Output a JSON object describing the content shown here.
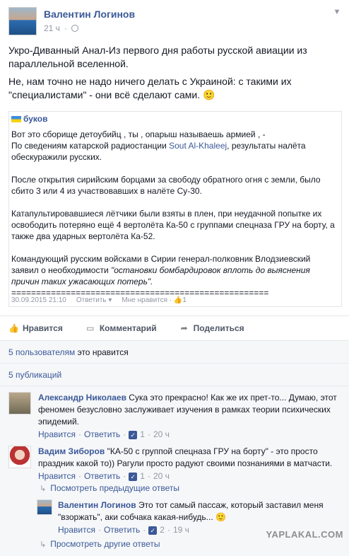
{
  "post": {
    "author": "Валентин Логинов",
    "time": "21 ч",
    "text1": "Укро-Диванный Анал-Из первого дня работы русской авиации из параллельной вселенной.",
    "text2": "Не, нам точно не надо ничего делать с Украиной: с такими их \"специалистами\" - они всё сделают сами. 🙂"
  },
  "shared": {
    "author": "буков",
    "line1": "Вот это сборище детоубийц , ты , опарыш называешь армией , -",
    "line2_pre": "По сведениям катарской радиостанции ",
    "line2_link": "Sout Al-Khaleej",
    "line2_post": ", результаты налёта обескуражили русских.",
    "para2": "После открытия сирийским борцами за свободу обратного огня с земли, было сбито 3 или 4 из участвовавших в налёте Су-30.",
    "para3": "Катапультировавшиеся лётчики были взяты в плен, при неудачной попытке их освободить потеряно ещё 4 вертолёта Ка-50 с группами спецназа ГРУ на борту, а также два ударных вертолёта Ка-52.",
    "para4_pre": "Командующий русским войсками в Сирии генерал-полковник Влодзиевский заявил о необходимости ",
    "para4_quote": "\"остановки бомбардировок вплоть до выяснения причин таких ужасающих потерь\".",
    "rule": "====================================================",
    "date": "30.09.2015 21:10",
    "reply": "Ответить",
    "like": "Мне нравится",
    "like_count": "1"
  },
  "actions": {
    "like": "Нравится",
    "comment": "Комментарий",
    "share": "Поделиться"
  },
  "stats": {
    "likes_link": "5 пользователям",
    "likes_rest": " это нравится",
    "shares": "5 публикаций"
  },
  "comments": [
    {
      "name": "Александр Николаев",
      "text": "Сука это прекрасно! Как же их прет-то... Думаю, этот феномен безусловно заслуживает изучения в рамках теории психических эпидемий.",
      "like": "Нравится",
      "reply": "Ответить",
      "count": "1",
      "time": "20 ч"
    },
    {
      "name": "Вадим Зиборов",
      "text": "\"КА-50 с группой спецназа ГРУ на борту\" - это просто праздник какой то)) Рагули просто радуют своими познаниями в матчасти.",
      "like": "Нравится",
      "reply": "Ответить",
      "count": "1",
      "time": "20 ч"
    },
    {
      "name": "Валентин Логинов",
      "text": "Это тот самый пассаж, который заставил меня \"взоржать\", аки собчака какая-нибудь... 🙂",
      "like": "Нравится",
      "reply": "Ответить",
      "count": "2",
      "time": "19 ч"
    }
  ],
  "prev_replies": "Посмотреть предыдущие ответы",
  "other_replies": "Просмотреть другие ответы",
  "watermark": "YAPLAKAL.COM",
  "icons": {
    "like": "thumbs-up-icon",
    "comment": "comment-icon",
    "share": "share-arrow-icon"
  }
}
